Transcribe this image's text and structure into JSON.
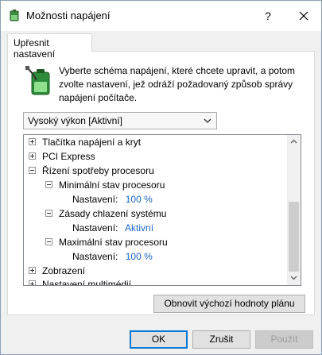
{
  "window": {
    "title": "Možnosti napájení",
    "help_label": "?",
    "close_icon": "close-icon"
  },
  "tab": {
    "label": "Upřesnit nastavení"
  },
  "description": "Vyberte schéma napájení, které chcete upravit, a potom zvolte nastavení, jež odráží požadovaný způsob správy napájení počítače.",
  "plan_select": {
    "value": "Vysoký výkon [Aktivní]"
  },
  "tree": {
    "items": [
      {
        "label": "Tlačítka napájení a kryt",
        "state": "collapsed"
      },
      {
        "label": "PCI Express",
        "state": "collapsed"
      },
      {
        "label": "Řízení spotřeby procesoru",
        "state": "expanded"
      },
      {
        "label": "Minimální stav procesoru",
        "state": "expanded"
      },
      {
        "setting_label": "Nastavení:",
        "value": "100 %"
      },
      {
        "label": "Zásady chlazení systému",
        "state": "expanded"
      },
      {
        "setting_label": "Nastavení:",
        "value": "Aktivní"
      },
      {
        "label": "Maximální stav procesoru",
        "state": "expanded"
      },
      {
        "setting_label": "Nastavení:",
        "value": "100 %"
      },
      {
        "label": "Zobrazení",
        "state": "collapsed"
      },
      {
        "label": "Nastavení multimédií",
        "state": "collapsed"
      }
    ]
  },
  "buttons": {
    "restore": "Obnovit výchozí hodnoty plánu",
    "ok": "OK",
    "cancel": "Zrušit",
    "apply": "Použít"
  },
  "colors": {
    "value_text": "#1a64c8",
    "ok_border": "#0078d7"
  }
}
